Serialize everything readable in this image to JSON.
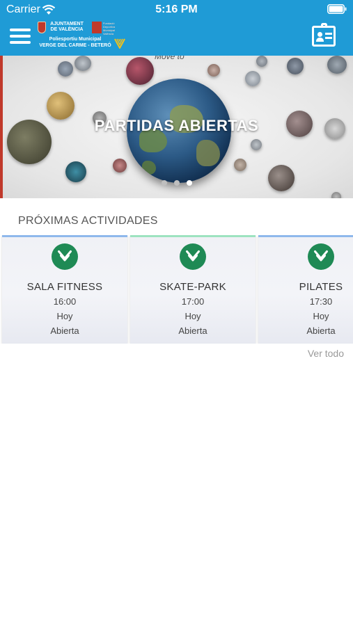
{
  "status_bar": {
    "carrier": "Carrier",
    "time": "5:16 PM"
  },
  "header": {
    "logo": {
      "ajuntament_line1": "AJUNTAMENT",
      "ajuntament_line2": "DE VALÈNCIA",
      "fundacio_line1": "Fundació",
      "fundacio_line2": "Deportiva",
      "fundacio_line3": "Municipal",
      "fundacio_line4": "València",
      "poli_line1": "Poliesportiu Municipal",
      "poli_line2": "VERGE DEL CARME - BETERÓ"
    },
    "menu_icon": "menu-icon",
    "profile_icon": "id-card-icon"
  },
  "banner": {
    "title": "PARTIDAS ABIERTAS",
    "top_text": "Move to",
    "dots_total": 3,
    "dots_active_index": 2
  },
  "section": {
    "title": "PRÓXIMAS ACTIVIDADES",
    "see_all": "Ver todo"
  },
  "activities": [
    {
      "name": "SALA FITNESS",
      "time": "16:00",
      "day": "Hoy",
      "status": "Abierta",
      "accent": "#8fb8ec",
      "icon": "check-circle-icon"
    },
    {
      "name": "SKATE-PARK",
      "time": "17:00",
      "day": "Hoy",
      "status": "Abierta",
      "accent": "#9de3c0",
      "icon": "check-circle-icon"
    },
    {
      "name": "PILATES",
      "time": "17:30",
      "day": "Hoy",
      "status": "Abierta",
      "accent": "#8fb8ec",
      "icon": "check-circle-icon"
    }
  ],
  "colors": {
    "nav": "#1f9bd6",
    "check": "#1f8a55"
  }
}
